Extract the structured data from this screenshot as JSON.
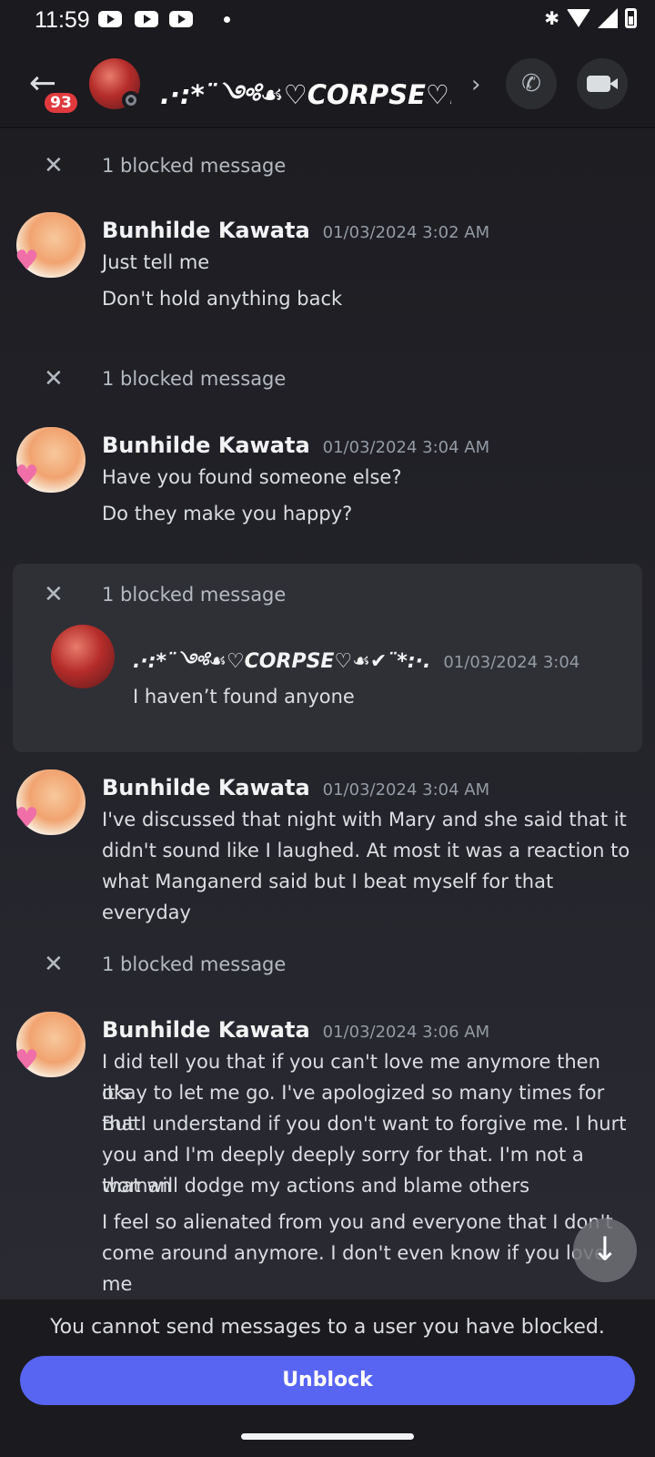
{
  "status_bar": {
    "time": "11:59"
  },
  "header": {
    "unread_badge": "93",
    "channel_name": ".·:*¨༺☙♡CORPSE♡..."
  },
  "blocked_label": "1 blocked message",
  "messages": [
    {
      "author": "Bunhilde Kawata",
      "timestamp": "01/03/2024 3:02 AM",
      "lines": [
        "Just tell me",
        "Don't hold anything back"
      ]
    },
    {
      "author": "Bunhilde Kawata",
      "timestamp": "01/03/2024 3:04 AM",
      "lines": [
        "Have you found someone else?",
        "Do they make you happy?"
      ]
    },
    {
      "author": "Bunhilde Kawata",
      "timestamp": "01/03/2024 3:04 AM",
      "lines": [
        "I've discussed that night with Mary and she said that it",
        "didn't sound like I laughed. At most it was a reaction to",
        "what Manganerd said but I beat myself for that everyday"
      ]
    },
    {
      "author": "Bunhilde Kawata",
      "timestamp": "01/03/2024 3:06 AM",
      "lines": [
        "I did tell you that if you can't love me anymore then it's",
        "okay to let me go. I've apologized so many times for that.",
        "But I understand if you don't want to forgive me. I hurt",
        "you and I'm deeply deeply sorry for that. I'm not a woman",
        "that will dodge my actions and blame others",
        "I feel so alienated from you and everyone that I don't",
        "come around anymore. I don't even know if you love me"
      ]
    }
  ],
  "revealed_blocked": {
    "author": ".·:*¨༺☙♡CORPSE♡☙✔¨*:·.",
    "timestamp": "01/03/2024 3:04",
    "text": "I haven’t found anyone"
  },
  "footer": {
    "notice": "You cannot send messages to a user you have blocked.",
    "unblock_label": "Unblock"
  },
  "icons": [
    "back-arrow-icon",
    "phone-call-icon",
    "video-camera-icon",
    "close-icon",
    "arrow-down-icon"
  ]
}
